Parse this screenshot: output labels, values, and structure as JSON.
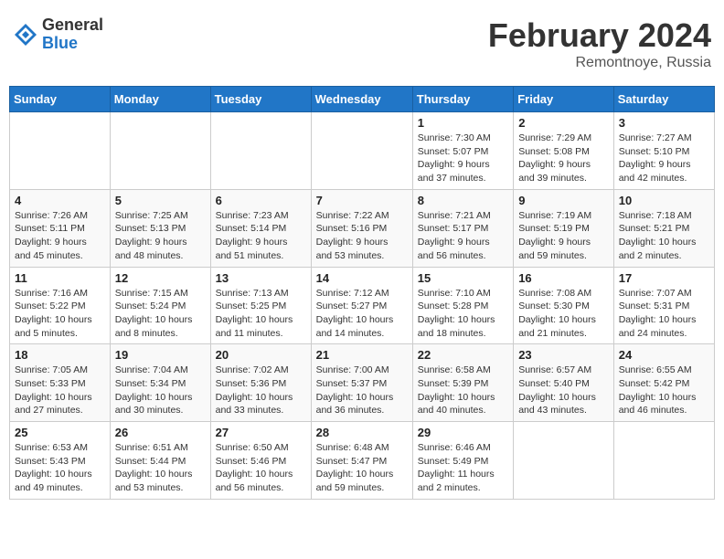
{
  "header": {
    "logo_general": "General",
    "logo_blue": "Blue",
    "title": "February 2024",
    "location": "Remontnoye, Russia"
  },
  "weekdays": [
    "Sunday",
    "Monday",
    "Tuesday",
    "Wednesday",
    "Thursday",
    "Friday",
    "Saturday"
  ],
  "weeks": [
    [
      {
        "day": "",
        "info": ""
      },
      {
        "day": "",
        "info": ""
      },
      {
        "day": "",
        "info": ""
      },
      {
        "day": "",
        "info": ""
      },
      {
        "day": "1",
        "info": "Sunrise: 7:30 AM\nSunset: 5:07 PM\nDaylight: 9 hours\nand 37 minutes."
      },
      {
        "day": "2",
        "info": "Sunrise: 7:29 AM\nSunset: 5:08 PM\nDaylight: 9 hours\nand 39 minutes."
      },
      {
        "day": "3",
        "info": "Sunrise: 7:27 AM\nSunset: 5:10 PM\nDaylight: 9 hours\nand 42 minutes."
      }
    ],
    [
      {
        "day": "4",
        "info": "Sunrise: 7:26 AM\nSunset: 5:11 PM\nDaylight: 9 hours\nand 45 minutes."
      },
      {
        "day": "5",
        "info": "Sunrise: 7:25 AM\nSunset: 5:13 PM\nDaylight: 9 hours\nand 48 minutes."
      },
      {
        "day": "6",
        "info": "Sunrise: 7:23 AM\nSunset: 5:14 PM\nDaylight: 9 hours\nand 51 minutes."
      },
      {
        "day": "7",
        "info": "Sunrise: 7:22 AM\nSunset: 5:16 PM\nDaylight: 9 hours\nand 53 minutes."
      },
      {
        "day": "8",
        "info": "Sunrise: 7:21 AM\nSunset: 5:17 PM\nDaylight: 9 hours\nand 56 minutes."
      },
      {
        "day": "9",
        "info": "Sunrise: 7:19 AM\nSunset: 5:19 PM\nDaylight: 9 hours\nand 59 minutes."
      },
      {
        "day": "10",
        "info": "Sunrise: 7:18 AM\nSunset: 5:21 PM\nDaylight: 10 hours\nand 2 minutes."
      }
    ],
    [
      {
        "day": "11",
        "info": "Sunrise: 7:16 AM\nSunset: 5:22 PM\nDaylight: 10 hours\nand 5 minutes."
      },
      {
        "day": "12",
        "info": "Sunrise: 7:15 AM\nSunset: 5:24 PM\nDaylight: 10 hours\nand 8 minutes."
      },
      {
        "day": "13",
        "info": "Sunrise: 7:13 AM\nSunset: 5:25 PM\nDaylight: 10 hours\nand 11 minutes."
      },
      {
        "day": "14",
        "info": "Sunrise: 7:12 AM\nSunset: 5:27 PM\nDaylight: 10 hours\nand 14 minutes."
      },
      {
        "day": "15",
        "info": "Sunrise: 7:10 AM\nSunset: 5:28 PM\nDaylight: 10 hours\nand 18 minutes."
      },
      {
        "day": "16",
        "info": "Sunrise: 7:08 AM\nSunset: 5:30 PM\nDaylight: 10 hours\nand 21 minutes."
      },
      {
        "day": "17",
        "info": "Sunrise: 7:07 AM\nSunset: 5:31 PM\nDaylight: 10 hours\nand 24 minutes."
      }
    ],
    [
      {
        "day": "18",
        "info": "Sunrise: 7:05 AM\nSunset: 5:33 PM\nDaylight: 10 hours\nand 27 minutes."
      },
      {
        "day": "19",
        "info": "Sunrise: 7:04 AM\nSunset: 5:34 PM\nDaylight: 10 hours\nand 30 minutes."
      },
      {
        "day": "20",
        "info": "Sunrise: 7:02 AM\nSunset: 5:36 PM\nDaylight: 10 hours\nand 33 minutes."
      },
      {
        "day": "21",
        "info": "Sunrise: 7:00 AM\nSunset: 5:37 PM\nDaylight: 10 hours\nand 36 minutes."
      },
      {
        "day": "22",
        "info": "Sunrise: 6:58 AM\nSunset: 5:39 PM\nDaylight: 10 hours\nand 40 minutes."
      },
      {
        "day": "23",
        "info": "Sunrise: 6:57 AM\nSunset: 5:40 PM\nDaylight: 10 hours\nand 43 minutes."
      },
      {
        "day": "24",
        "info": "Sunrise: 6:55 AM\nSunset: 5:42 PM\nDaylight: 10 hours\nand 46 minutes."
      }
    ],
    [
      {
        "day": "25",
        "info": "Sunrise: 6:53 AM\nSunset: 5:43 PM\nDaylight: 10 hours\nand 49 minutes."
      },
      {
        "day": "26",
        "info": "Sunrise: 6:51 AM\nSunset: 5:44 PM\nDaylight: 10 hours\nand 53 minutes."
      },
      {
        "day": "27",
        "info": "Sunrise: 6:50 AM\nSunset: 5:46 PM\nDaylight: 10 hours\nand 56 minutes."
      },
      {
        "day": "28",
        "info": "Sunrise: 6:48 AM\nSunset: 5:47 PM\nDaylight: 10 hours\nand 59 minutes."
      },
      {
        "day": "29",
        "info": "Sunrise: 6:46 AM\nSunset: 5:49 PM\nDaylight: 11 hours\nand 2 minutes."
      },
      {
        "day": "",
        "info": ""
      },
      {
        "day": "",
        "info": ""
      }
    ]
  ]
}
